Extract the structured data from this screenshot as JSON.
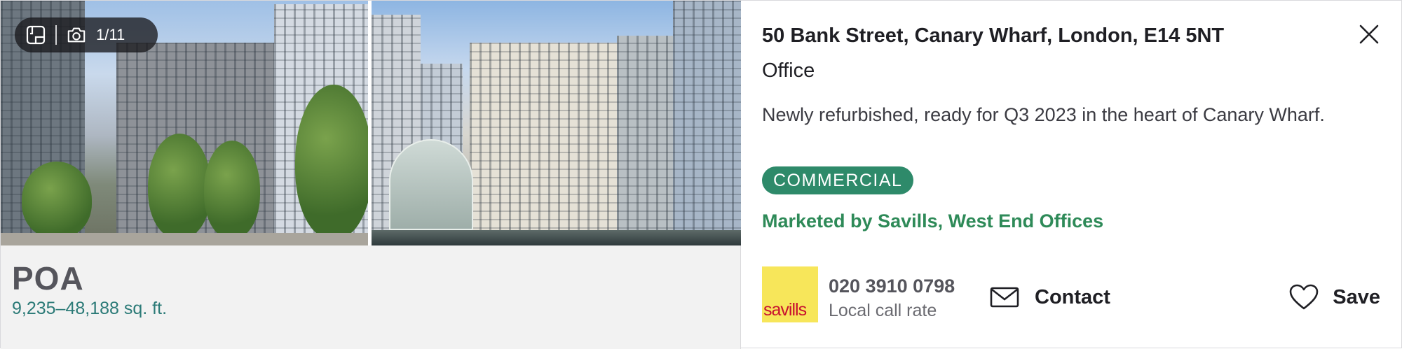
{
  "gallery": {
    "counter": "1/11",
    "floorplan_icon": "floorplan-icon",
    "camera_icon": "camera-icon"
  },
  "listing": {
    "price": "POA",
    "size": "9,235–48,188 sq. ft.",
    "address": "50 Bank Street, Canary Wharf, London, E14 5NT",
    "property_type": "Office",
    "summary": "Newly refurbished, ready for Q3 2023 in the heart of Canary Wharf.",
    "badge": "COMMERCIAL",
    "marketed_by": "Marketed by Savills, West End Offices"
  },
  "agent": {
    "logo_text": "savills",
    "phone": "020 3910 0798",
    "rate_note": "Local call rate"
  },
  "actions": {
    "contact_label": "Contact",
    "save_label": "Save",
    "close_icon": "close-icon",
    "mail_icon": "mail-icon",
    "heart_icon": "heart-icon"
  },
  "colors": {
    "badge_bg": "#2e8a6a",
    "marketed_text": "#2e8a58",
    "size_text": "#2b7a77",
    "logo_bg": "#f7e65a",
    "logo_text": "#c8102e"
  }
}
